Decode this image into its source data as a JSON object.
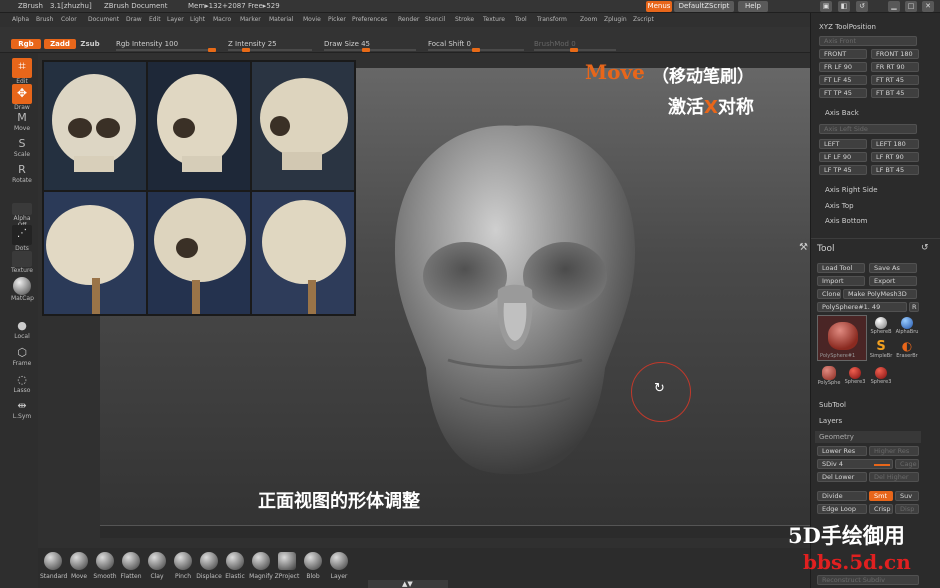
{
  "titlebar": {
    "app": "ZBrush",
    "version": "3.1[zhuzhu]",
    "document": "ZBrush Document",
    "mem": "Mem▸132+2087 Free▸529",
    "menus_btn": "Menus",
    "script_btn": "DefaultZScript",
    "help_btn": "Help"
  },
  "menubar": [
    "Alpha",
    "Brush",
    "Color",
    "Document",
    "Draw",
    "Edit",
    "Layer",
    "Light",
    "Macro",
    "Marker",
    "Material",
    "Movie",
    "Picker",
    "Preferences",
    "Render",
    "Stencil",
    "Stroke",
    "Texture",
    "Tool",
    "Transform",
    "Zoom",
    "Zplugin",
    "Zscript"
  ],
  "shelf": {
    "rgb": "Rgb",
    "zadd": "Zadd",
    "zsub": "Zsub",
    "rgb_intensity": "Rgb Intensity 100",
    "z_intensity": "Z Intensity 25",
    "draw_size": "Draw Size 45",
    "focal_shift": "Focal Shift 0",
    "brushmod": "BrushMod 0"
  },
  "left_tools": [
    {
      "label": "Edit",
      "icon": "edit-icon"
    },
    {
      "label": "Draw",
      "icon": "draw-icon"
    },
    {
      "label": "Move",
      "icon": "move-icon"
    },
    {
      "label": "Scale",
      "icon": "scale-icon"
    },
    {
      "label": "Rotate",
      "icon": "rotate-icon"
    },
    {
      "label": "Alpha Off",
      "icon": "alpha-icon"
    },
    {
      "label": "Dots",
      "icon": "dots-icon"
    },
    {
      "label": "Texture",
      "icon": "texture-icon"
    },
    {
      "label": "MatCap",
      "icon": "matcap-icon"
    },
    {
      "label": "Local",
      "icon": "local-icon"
    },
    {
      "label": "Frame",
      "icon": "frame-icon"
    },
    {
      "label": "Lasso",
      "icon": "lasso-icon"
    },
    {
      "label": "L.Sym",
      "icon": "symmetry-icon"
    }
  ],
  "overlay": {
    "move_title": "Move",
    "move_subtitle": "（移动笔刷）",
    "activate_x": "激活",
    "x_letter": "X",
    "symmetry": "对称",
    "caption": "正面视图的形体调整",
    "watermark1": "5D手绘御用",
    "watermark2": "bbs.5d.cn"
  },
  "bottom_brushes": [
    "Standard",
    "Move",
    "Smooth",
    "Flatten",
    "Clay",
    "Pinch",
    "Displace",
    "Elastic",
    "Magnify",
    "ZProject",
    "Blob",
    "Layer"
  ],
  "right_panel": {
    "xyz_header": "XYZ ToolPosition",
    "axis_front": "Axis Front",
    "front_rows": [
      [
        "FRONT",
        "FRONT 180"
      ],
      [
        "FR LF 90",
        "FR RT 90"
      ],
      [
        "FT LF 45",
        "FT RT 45"
      ],
      [
        "FT TP 45",
        "FT BT 45"
      ]
    ],
    "axis_back": "Axis Back",
    "axis_left_side": "Axis Left Side",
    "left_rows": [
      [
        "LEFT",
        "LEFT 180"
      ],
      [
        "LF LF 90",
        "LF RT 90"
      ],
      [
        "LF TP 45",
        "LF BT 45"
      ]
    ],
    "axis_right_side": "Axis Right Side",
    "axis_top": "Axis Top",
    "axis_bottom": "Axis Bottom",
    "tool_header": "Tool",
    "load_tool": "Load Tool",
    "save_as": "Save As",
    "import": "Import",
    "export": "Export",
    "clone": "Clone",
    "make_polymesh": "Make PolyMesh3D",
    "current_tool": "PolySphere#1. 49",
    "r_btn": "R",
    "thumbs": [
      "PolySphere#1",
      "SphereB",
      "AlphaBru",
      "SimpleBr",
      "EraserBr",
      "PolySphe",
      "Sphere3",
      "Sphere3"
    ],
    "subtool": "SubTool",
    "layers": "Layers",
    "geometry": "Geometry",
    "lower_res": "Lower Res",
    "higher_res": "Higher Res",
    "sdiv": "SDiv 4",
    "cage": "Cage",
    "del_lower": "Del Lower",
    "del_higher": "Del Higher",
    "divide": "Divide",
    "smt": "Smt",
    "suv": "Suv",
    "edge_loop": "Edge Loop",
    "crisp": "Crisp",
    "disp": "Disp",
    "reconstruct": "Reconstruct Subdiv"
  },
  "colors": {
    "accent": "#e8661a",
    "panel": "#2b2b2b",
    "canvas_bg": "#4a4a4a"
  }
}
